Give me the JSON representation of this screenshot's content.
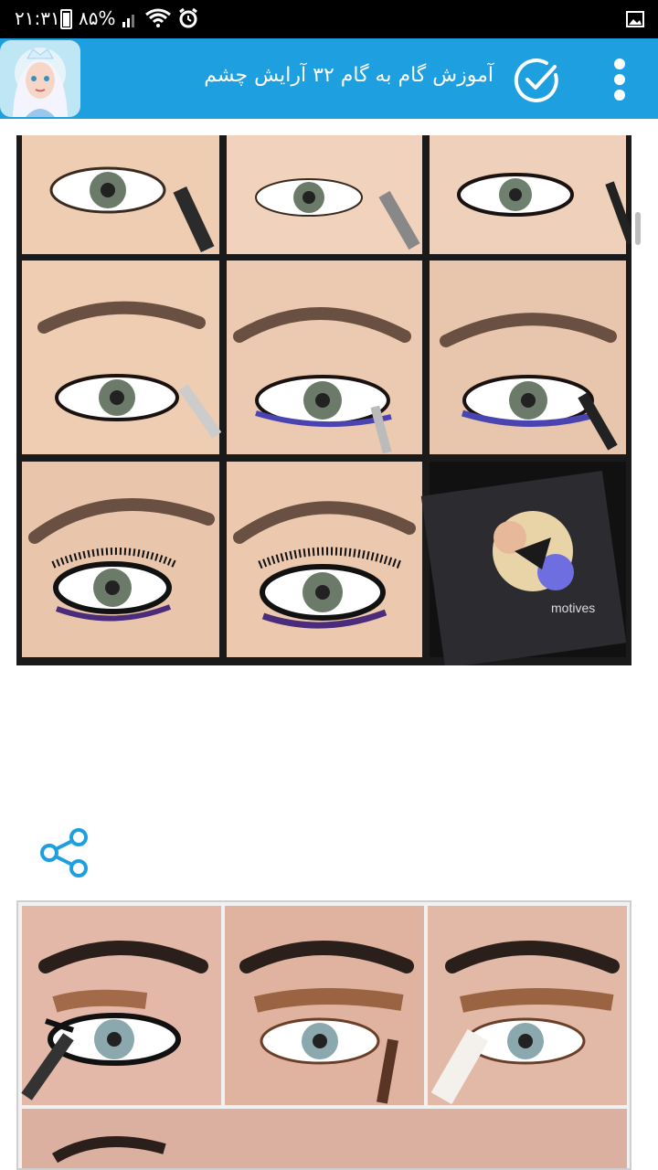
{
  "status_bar": {
    "time": "۲۱:۳۱",
    "battery": "۸۵%",
    "icons": [
      "battery-icon",
      "signal-icon",
      "wifi-icon",
      "alarm-icon",
      "gallery-icon"
    ]
  },
  "app_bar": {
    "title": "آموزش گام به گام ۳۲ آرایش چشم",
    "background_color": "#1e9fe0",
    "avatar_icon": "princess-avatar-icon",
    "check_icon": "check-circle-icon",
    "menu_icon": "overflow-menu-icon"
  },
  "content": {
    "image1": {
      "description_icon": "eye-makeup-steps-image",
      "product_text": "motives"
    },
    "share_icon": "share-icon",
    "image2": {
      "description_icon": "eye-makeup-steps-image"
    }
  }
}
